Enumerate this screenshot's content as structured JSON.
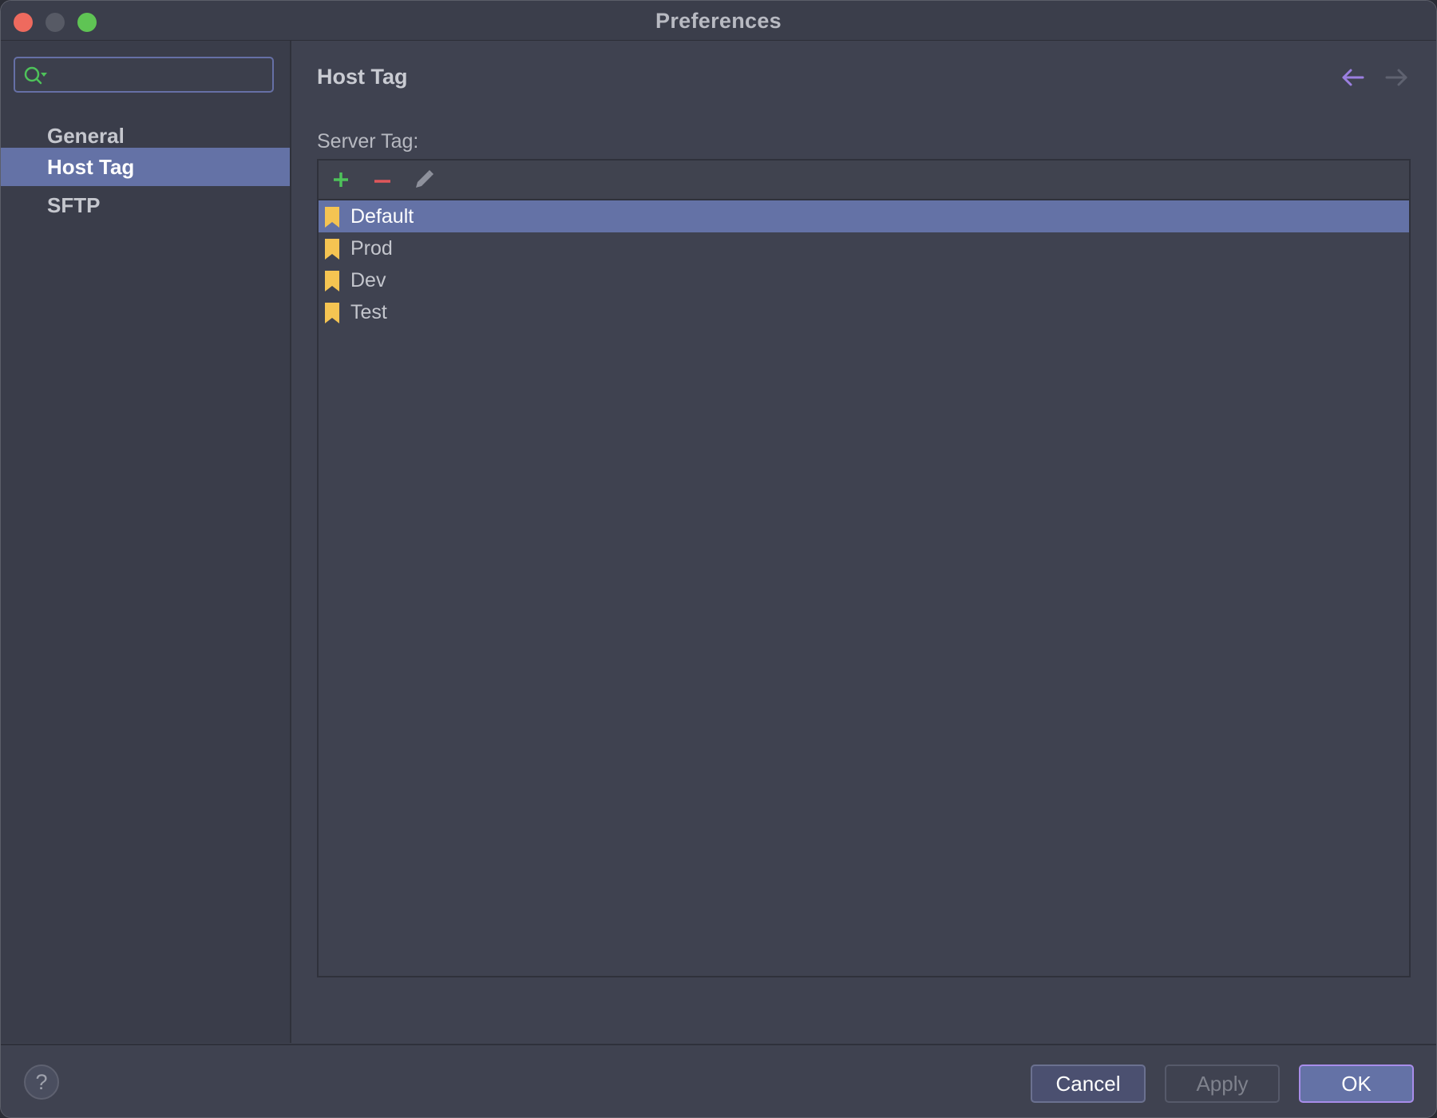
{
  "window": {
    "title": "Preferences"
  },
  "sidebar": {
    "search": {
      "value": "",
      "placeholder": ""
    },
    "items": [
      {
        "label": "General",
        "selected": false
      },
      {
        "label": "Host Tag",
        "selected": true
      },
      {
        "label": "SFTP",
        "selected": false
      }
    ]
  },
  "main": {
    "title": "Host Tag",
    "section_label": "Server Tag:",
    "toolbar": {
      "add_icon": "plus-icon",
      "remove_icon": "minus-icon",
      "edit_icon": "pencil-icon"
    },
    "tags": [
      {
        "label": "Default",
        "selected": true,
        "icon": "bookmark-icon"
      },
      {
        "label": "Prod",
        "selected": false,
        "icon": "bookmark-icon"
      },
      {
        "label": "Dev",
        "selected": false,
        "icon": "bookmark-icon"
      },
      {
        "label": "Test",
        "selected": false,
        "icon": "bookmark-icon"
      }
    ]
  },
  "footer": {
    "help_label": "?",
    "cancel_label": "Cancel",
    "apply_label": "Apply",
    "ok_label": "OK"
  },
  "colors": {
    "accent": "#6472a6",
    "tag_icon": "#f5c452",
    "add": "#4ec25a",
    "remove": "#e0575b",
    "back_arrow": "#9b7fe0"
  }
}
